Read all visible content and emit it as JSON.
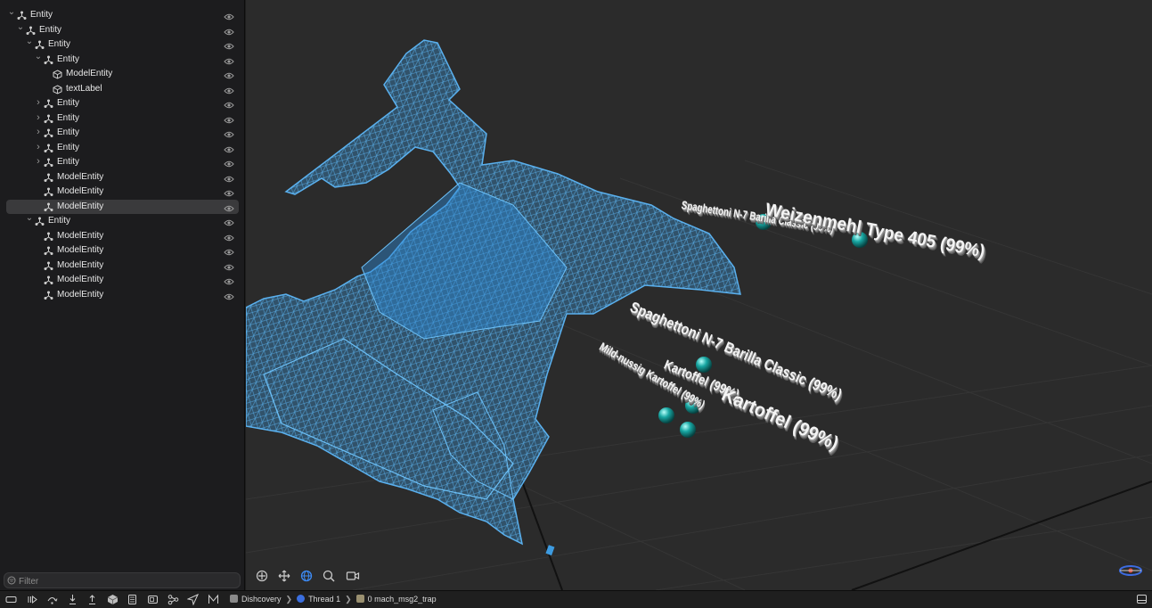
{
  "sidebar": {
    "items": [
      {
        "label": "Entity",
        "depth": 0,
        "expanded": true,
        "icon": "entity-icon"
      },
      {
        "label": "Entity",
        "depth": 1,
        "expanded": true,
        "icon": "entity-icon"
      },
      {
        "label": "Entity",
        "depth": 2,
        "expanded": true,
        "icon": "entity-icon"
      },
      {
        "label": "Entity",
        "depth": 3,
        "expanded": true,
        "icon": "entity-icon"
      },
      {
        "label": "ModelEntity",
        "depth": 4,
        "icon": "cube-icon"
      },
      {
        "label": "textLabel",
        "depth": 4,
        "icon": "cube-icon"
      },
      {
        "label": "Entity",
        "depth": 3,
        "expanded": false,
        "icon": "entity-icon"
      },
      {
        "label": "Entity",
        "depth": 3,
        "expanded": false,
        "icon": "entity-icon"
      },
      {
        "label": "Entity",
        "depth": 3,
        "expanded": false,
        "icon": "entity-icon"
      },
      {
        "label": "Entity",
        "depth": 3,
        "expanded": false,
        "icon": "entity-icon"
      },
      {
        "label": "Entity",
        "depth": 3,
        "expanded": false,
        "icon": "entity-icon"
      },
      {
        "label": "ModelEntity",
        "depth": 3,
        "icon": "entity-icon"
      },
      {
        "label": "ModelEntity",
        "depth": 3,
        "icon": "entity-icon"
      },
      {
        "label": "ModelEntity",
        "depth": 3,
        "icon": "entity-icon",
        "selected": true
      },
      {
        "label": "Entity",
        "depth": 2,
        "expanded": true,
        "icon": "entity-icon"
      },
      {
        "label": "ModelEntity",
        "depth": 3,
        "icon": "entity-icon"
      },
      {
        "label": "ModelEntity",
        "depth": 3,
        "icon": "entity-icon"
      },
      {
        "label": "ModelEntity",
        "depth": 3,
        "icon": "entity-icon"
      },
      {
        "label": "ModelEntity",
        "depth": 3,
        "icon": "entity-icon"
      },
      {
        "label": "ModelEntity",
        "depth": 3,
        "icon": "entity-icon"
      }
    ],
    "filter_placeholder": "Filter"
  },
  "viewport": {
    "labels": [
      {
        "text": "Spaghettoni N-7 Barilla Classic (99%)"
      },
      {
        "text": "Weizenmehl Type 405 (99%)"
      },
      {
        "text": "Spaghettoni N-7 Barilla Classic (99%)"
      },
      {
        "text": "Kartoffel (99%)"
      },
      {
        "text": "Mild-nussig Kartoffel (99%)"
      },
      {
        "text": "Kartoffel (99%)"
      }
    ],
    "mesh_color": "#3d9be0",
    "sphere_color": "#18a7a3",
    "toolbar_icons": [
      "move-icon",
      "pan-icon",
      "orbit-icon",
      "zoom-icon",
      "camera-icon"
    ]
  },
  "debugbar": {
    "app": "Dishcovery",
    "thread": "Thread 1",
    "frame": "0 mach_msg2_trap"
  }
}
